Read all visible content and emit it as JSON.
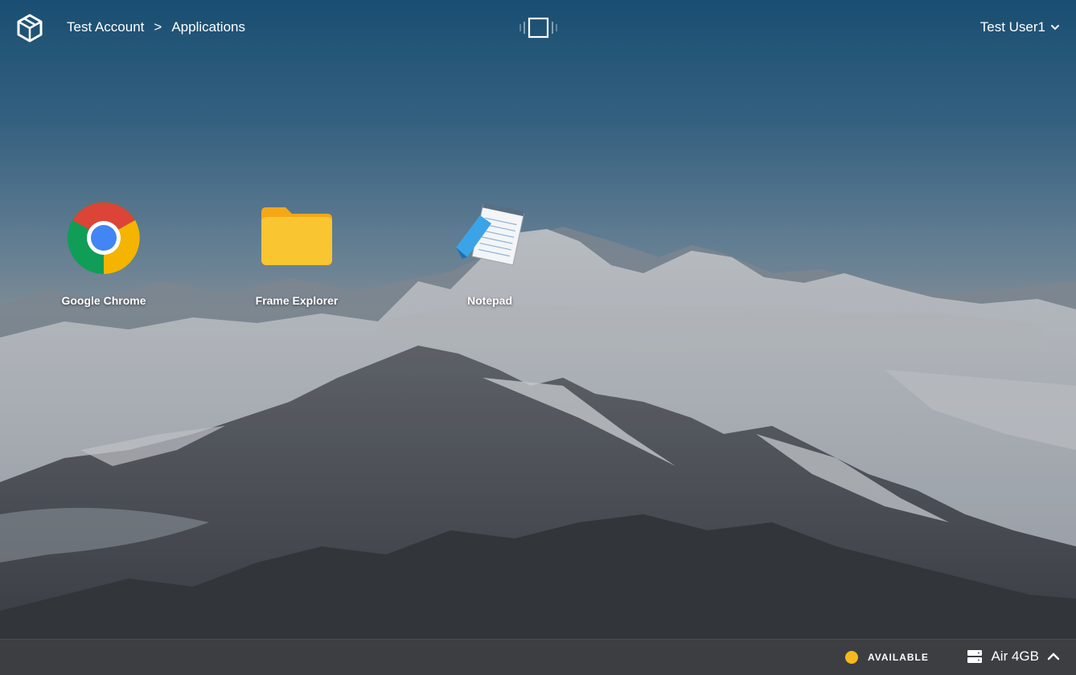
{
  "topbar": {
    "breadcrumb": [
      "Test Account",
      ">",
      "Applications"
    ],
    "user_name": "Test User1",
    "logo_icon": "cube-logo-icon",
    "center_icon": "session-display-icon",
    "user_chevron_icon": "chevron-down-icon"
  },
  "apps": [
    {
      "label": "Google Chrome",
      "icon": "chrome-icon"
    },
    {
      "label": "Frame Explorer",
      "icon": "folder-icon"
    },
    {
      "label": "Notepad",
      "icon": "notepad-icon"
    }
  ],
  "bottombar": {
    "status_text": "AVAILABLE",
    "status_color": "#f7b81d",
    "instance_label": "Air 4GB",
    "instance_icon": "server-icon",
    "expand_icon": "chevron-up-icon"
  },
  "colors": {
    "sky_top": "#1d5a82",
    "folder_yellow": "#f9c531",
    "chrome_red": "#db4437",
    "chrome_green": "#0f9d58",
    "chrome_yellow": "#f4b400",
    "chrome_blue": "#4285f4"
  }
}
